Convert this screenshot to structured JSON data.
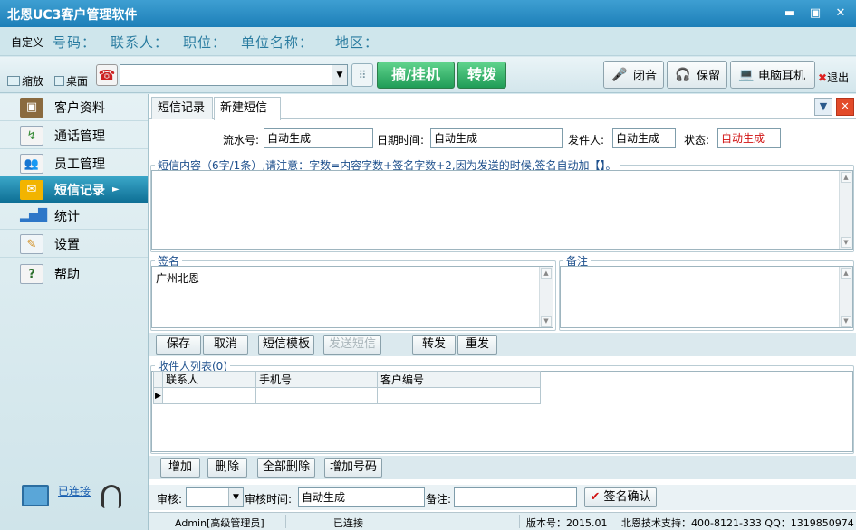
{
  "window": {
    "title": "北恩UC3客户管理软件"
  },
  "infobar": {
    "custom": "自定义",
    "number_label": "号码：",
    "contact_label": "联系人：",
    "position_label": "职位：",
    "company_label": "单位名称：",
    "region_label": "地区："
  },
  "toolbar": {
    "shrink": "缩放",
    "desktop": "桌面",
    "dial_value": "",
    "pickup": "摘/挂机",
    "transfer": "转拨",
    "mute": "闭音",
    "hold": "保留",
    "pc_headset": "电脑耳机",
    "exit": "退出"
  },
  "sidebar": {
    "items": [
      {
        "label": "客户资料",
        "icon": "customer-icon"
      },
      {
        "label": "通话管理",
        "icon": "call-icon"
      },
      {
        "label": "员工管理",
        "icon": "staff-icon"
      },
      {
        "label": "短信记录",
        "icon": "sms-icon"
      },
      {
        "label": "统计",
        "icon": "chart-icon"
      },
      {
        "label": "设置",
        "icon": "settings-icon"
      },
      {
        "label": "帮助",
        "icon": "help-icon"
      }
    ],
    "connection": "已连接"
  },
  "tabs": [
    "短信记录",
    "新建短信"
  ],
  "form": {
    "serial_label": "流水号:",
    "serial_value": "自动生成",
    "datetime_label": "日期时间:",
    "datetime_value": "自动生成",
    "sender_label": "发件人:",
    "sender_value": "自动生成",
    "status_label": "状态:",
    "status_value": "自动生成"
  },
  "sms": {
    "legend": "短信内容（6字/1条）,请注意：字数=内容字数+签名字数+2,因为发送的时候,签名自动加【】。",
    "content": ""
  },
  "signature": {
    "legend": "签名",
    "value": "广州北恩"
  },
  "remark": {
    "legend": "备注",
    "value": ""
  },
  "actions": {
    "save": "保存",
    "cancel": "取消",
    "template": "短信模板",
    "send": "发送短信",
    "forward": "转发",
    "resend": "重发"
  },
  "recipients": {
    "legend": "收件人列表(0)",
    "columns": [
      "联系人",
      "手机号",
      "客户编号"
    ],
    "add": "增加",
    "delete": "删除",
    "delete_all": "全部删除",
    "add_number": "增加号码"
  },
  "review": {
    "review_label": "审核:",
    "review_value": "",
    "review_time_label": "审核时间:",
    "review_time_value": "自动生成",
    "remark_label": "备注:",
    "remark_value": "",
    "confirm": "签名确认"
  },
  "status": {
    "user": "Admin[高级管理员]",
    "connection": "已连接",
    "version": "版本号：2015.01",
    "support": "北恩技术支持：400-8121-333 QQ：1319850974"
  }
}
